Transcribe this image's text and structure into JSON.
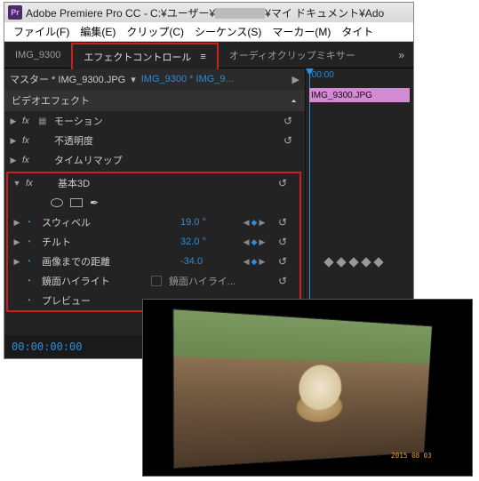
{
  "titlebar": {
    "app": "Adobe Premiere Pro CC",
    "path_prefix": " - C:¥ユーザー¥",
    "path_suffix": "¥マイ ドキュメント¥Ado"
  },
  "menubar": {
    "file": "ファイル(F)",
    "edit": "編集(E)",
    "clip": "クリップ(C)",
    "sequence": "シーケンス(S)",
    "marker": "マーカー(M)",
    "title": "タイト"
  },
  "tabs": {
    "source": "IMG_9300",
    "effect_controls": "エフェクトコントロール",
    "audio_mixer": "オーディオクリップミキサー",
    "more": "»"
  },
  "master": {
    "label": "マスター * IMG_9300.JPG",
    "sequence": "IMG_9300 * IMG_9..."
  },
  "video_effects": "ビデオエフェクト",
  "rows": {
    "motion": "モーション",
    "opacity": "不透明度",
    "time_remap": "タイムリマップ",
    "basic3d": "基本3D",
    "swivel": {
      "label": "スウィベル",
      "value": "19.0 °"
    },
    "tilt": {
      "label": "チルト",
      "value": "32.0 °"
    },
    "distance": {
      "label": "画像までの距離",
      "value": "-34.0"
    },
    "specular": {
      "label": "鏡面ハイライト",
      "checkbox_label": "鏡面ハイライ..."
    },
    "preview": "プレビュー"
  },
  "reset_glyph": "↺",
  "timeline": {
    "ruler_label": ":00:00",
    "clip_name": "IMG_9300.JPG"
  },
  "timecode": "00:00:00:00",
  "preview_timestamp": "2015 08 03"
}
